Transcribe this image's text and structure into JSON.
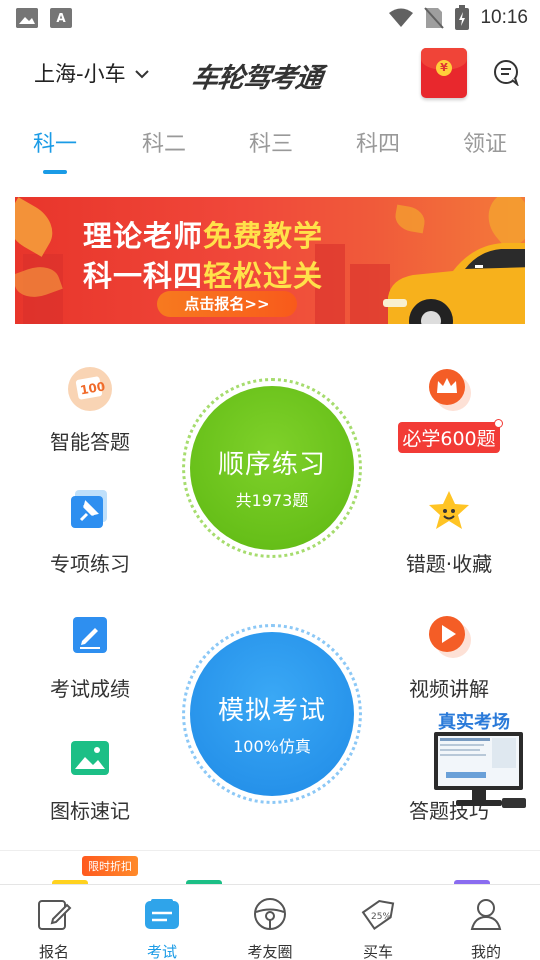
{
  "status_bar": {
    "time": "10:16"
  },
  "header": {
    "city": "上海-小车",
    "logo": "车轮驾考通"
  },
  "tabs": [
    {
      "label": "科一",
      "active": true
    },
    {
      "label": "科二"
    },
    {
      "label": "科三"
    },
    {
      "label": "科四"
    },
    {
      "label": "领证"
    }
  ],
  "banner": {
    "line1_a": "理论老师",
    "line1_b": "免费教学",
    "line2_a": "科一科四",
    "line2_b": "轻松过关",
    "button": "点击报名>>"
  },
  "left_items": [
    {
      "label": "智能答题",
      "icon": "score-100-icon"
    },
    {
      "label": "专项练习",
      "icon": "pin-icon"
    },
    {
      "label": "考试成绩",
      "icon": "pencil-note-icon"
    },
    {
      "label": "图标速记",
      "icon": "image-icon"
    }
  ],
  "right_items": [
    {
      "label": "必学600题",
      "icon": "crown-icon"
    },
    {
      "label": "错题·收藏",
      "icon": "star-icon"
    },
    {
      "label": "视频讲解",
      "icon": "play-icon"
    },
    {
      "label": "答题技巧",
      "icon": "monitor-icon"
    }
  ],
  "sequential": {
    "title": "顺序练习",
    "sub": "共1973题"
  },
  "mock_exam": {
    "title": "模拟考试",
    "sub": "100%仿真"
  },
  "overlay": {
    "title": "真实考场"
  },
  "promo": {
    "tag": "限时折扣"
  },
  "bottom_nav": [
    {
      "label": "报名",
      "icon": "signup-icon"
    },
    {
      "label": "考试",
      "icon": "exam-icon",
      "active": true
    },
    {
      "label": "考友圈",
      "icon": "steering-wheel-icon"
    },
    {
      "label": "买车",
      "icon": "discount-tag-icon"
    },
    {
      "label": "我的",
      "icon": "profile-icon"
    }
  ],
  "colors": {
    "accent": "#1a9be6",
    "green": "#6cc318",
    "blue": "#2596ef",
    "red": "#f23b36"
  }
}
